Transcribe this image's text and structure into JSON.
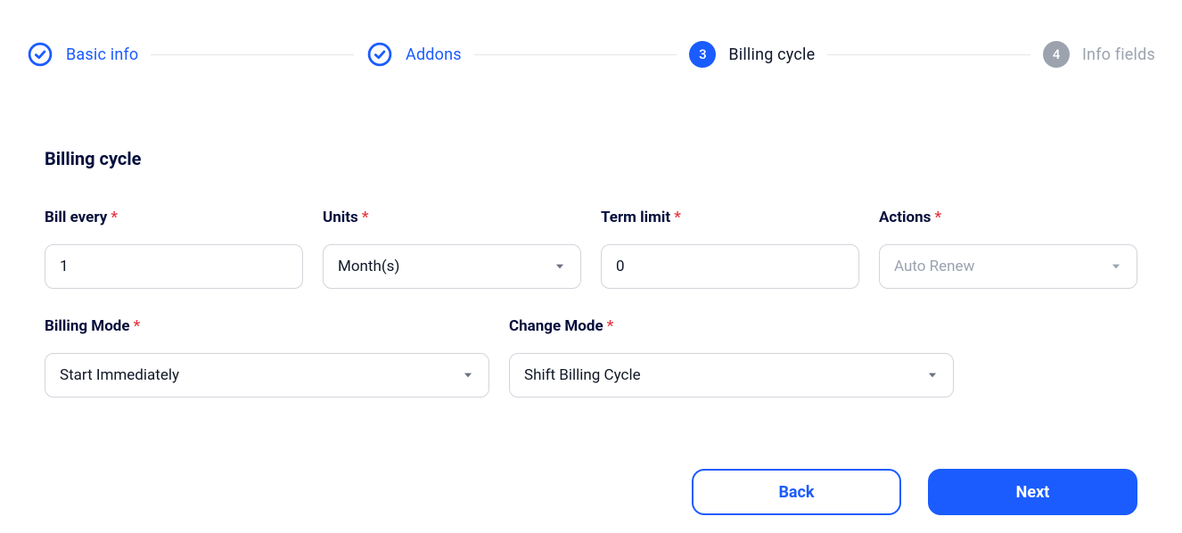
{
  "stepper": {
    "steps": [
      {
        "label": "Basic info",
        "state": "completed"
      },
      {
        "label": "Addons",
        "state": "completed"
      },
      {
        "label": "Billing cycle",
        "state": "active",
        "number": "3"
      },
      {
        "label": "Info fields",
        "state": "upcoming",
        "number": "4"
      }
    ]
  },
  "section": {
    "title": "Billing cycle"
  },
  "fields": {
    "billEvery": {
      "label": "Bill every",
      "value": "1"
    },
    "units": {
      "label": "Units",
      "value": "Month(s)"
    },
    "termLimit": {
      "label": "Term limit",
      "value": "0"
    },
    "actions": {
      "label": "Actions",
      "value": "Auto Renew"
    },
    "billingMode": {
      "label": "Billing Mode",
      "value": "Start Immediately"
    },
    "changeMode": {
      "label": "Change Mode",
      "value": "Shift Billing Cycle"
    }
  },
  "buttons": {
    "back": "Back",
    "next": "Next"
  }
}
